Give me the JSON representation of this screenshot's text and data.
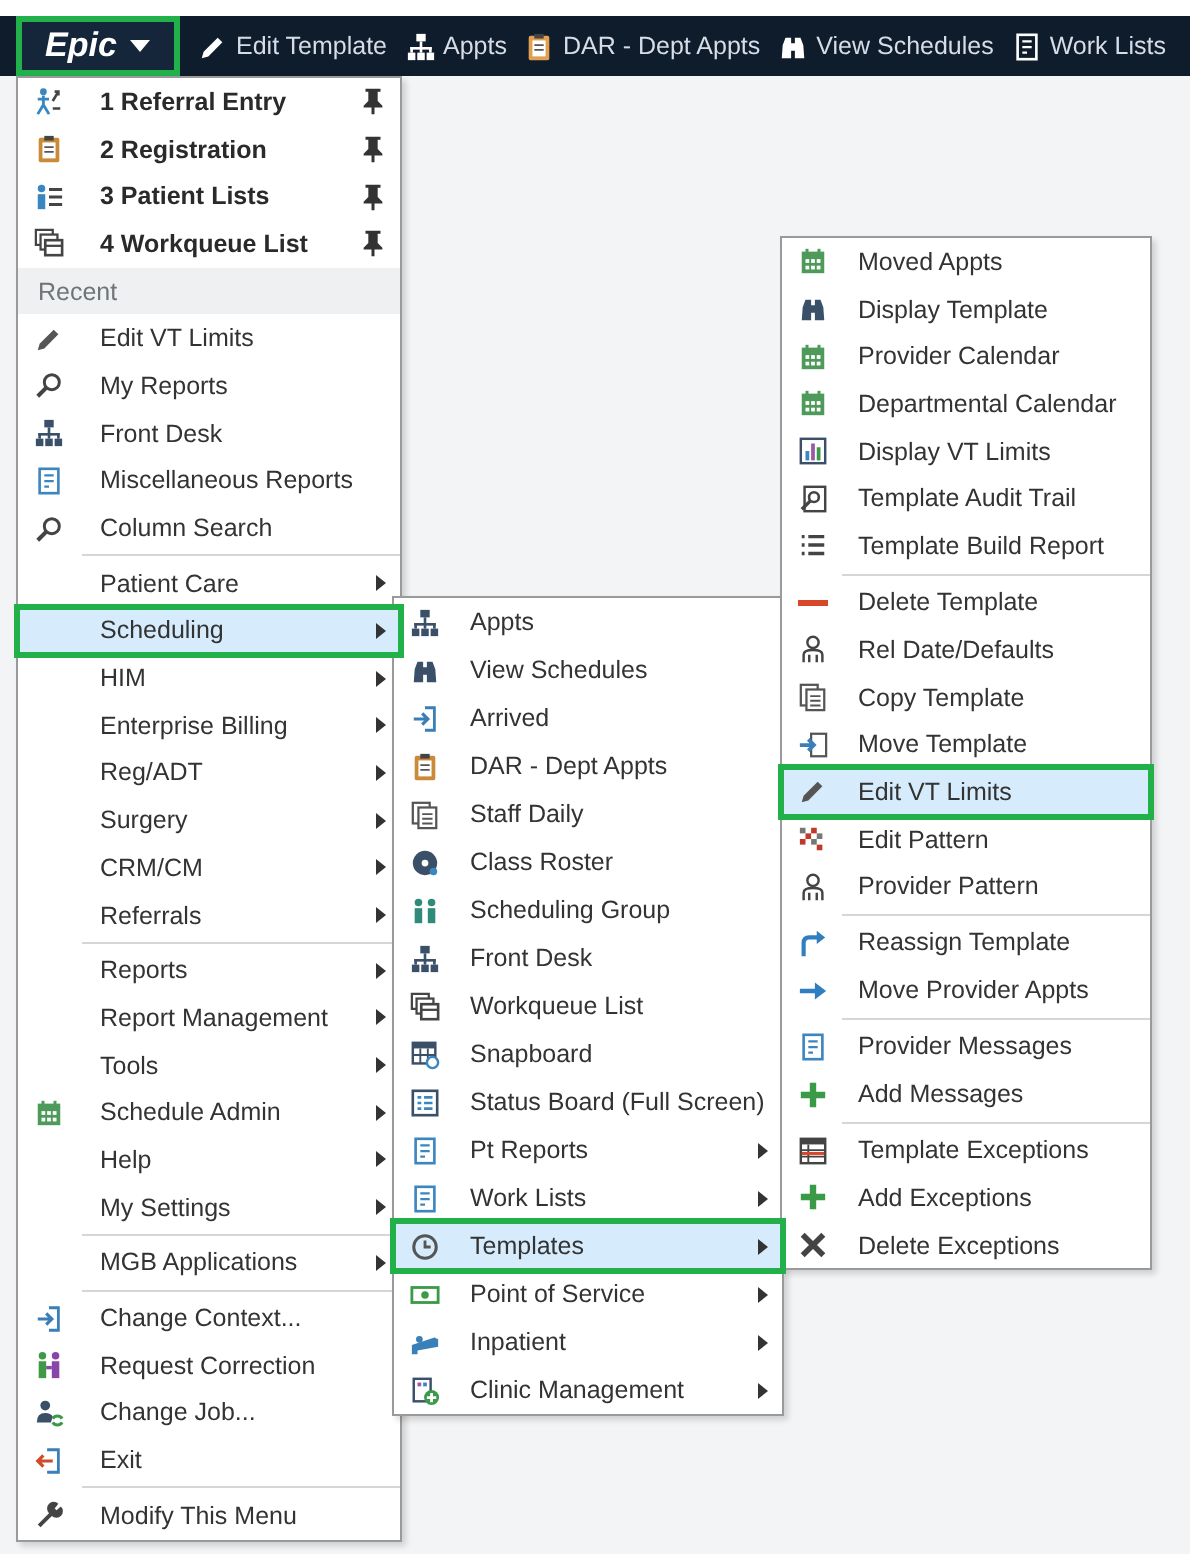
{
  "toolbar": {
    "menu_button": {
      "label": "Epic",
      "highlighted": true
    },
    "items": [
      {
        "label": "Edit Template"
      },
      {
        "label": "Appts"
      },
      {
        "label": "DAR - Dept Appts"
      },
      {
        "label": "View Schedules"
      },
      {
        "label": "Work Lists"
      }
    ]
  },
  "main_menu": {
    "entries": [
      {
        "kind": "item",
        "label": "1 Referral Entry",
        "pinned": true,
        "submenu": false,
        "selected": false
      },
      {
        "kind": "item",
        "label": "2 Registration",
        "pinned": true,
        "submenu": false,
        "selected": false
      },
      {
        "kind": "item",
        "label": "3 Patient Lists",
        "pinned": true,
        "submenu": false,
        "selected": false
      },
      {
        "kind": "item",
        "label": "4 Workqueue List",
        "pinned": true,
        "submenu": false,
        "selected": false
      },
      {
        "kind": "header",
        "label": "Recent"
      },
      {
        "kind": "item",
        "label": "Edit VT Limits",
        "pinned": false,
        "submenu": false,
        "selected": false
      },
      {
        "kind": "item",
        "label": "My Reports",
        "pinned": false,
        "submenu": false,
        "selected": false
      },
      {
        "kind": "item",
        "label": "Front Desk",
        "pinned": false,
        "submenu": false,
        "selected": false
      },
      {
        "kind": "item",
        "label": "Miscellaneous Reports",
        "pinned": false,
        "submenu": false,
        "selected": false
      },
      {
        "kind": "item",
        "label": "Column Search",
        "pinned": false,
        "submenu": false,
        "selected": false
      },
      {
        "kind": "separator"
      },
      {
        "kind": "item",
        "label": "Patient Care",
        "pinned": false,
        "submenu": true,
        "selected": false
      },
      {
        "kind": "item",
        "label": "Scheduling",
        "pinned": false,
        "submenu": true,
        "selected": true
      },
      {
        "kind": "item",
        "label": "HIM",
        "pinned": false,
        "submenu": true,
        "selected": false
      },
      {
        "kind": "item",
        "label": "Enterprise Billing",
        "pinned": false,
        "submenu": true,
        "selected": false
      },
      {
        "kind": "item",
        "label": "Reg/ADT",
        "pinned": false,
        "submenu": true,
        "selected": false
      },
      {
        "kind": "item",
        "label": "Surgery",
        "pinned": false,
        "submenu": true,
        "selected": false
      },
      {
        "kind": "item",
        "label": "CRM/CM",
        "pinned": false,
        "submenu": true,
        "selected": false
      },
      {
        "kind": "item",
        "label": "Referrals",
        "pinned": false,
        "submenu": true,
        "selected": false
      },
      {
        "kind": "separator"
      },
      {
        "kind": "item",
        "label": "Reports",
        "pinned": false,
        "submenu": true,
        "selected": false
      },
      {
        "kind": "item",
        "label": "Report Management",
        "pinned": false,
        "submenu": true,
        "selected": false
      },
      {
        "kind": "item",
        "label": "Tools",
        "pinned": false,
        "submenu": true,
        "selected": false
      },
      {
        "kind": "item",
        "label": "Schedule Admin",
        "pinned": false,
        "submenu": true,
        "selected": false
      },
      {
        "kind": "item",
        "label": "Help",
        "pinned": false,
        "submenu": true,
        "selected": false
      },
      {
        "kind": "item",
        "label": "My Settings",
        "pinned": false,
        "submenu": true,
        "selected": false
      },
      {
        "kind": "separator"
      },
      {
        "kind": "item",
        "label": "MGB Applications",
        "pinned": false,
        "submenu": true,
        "selected": false
      },
      {
        "kind": "separator"
      },
      {
        "kind": "item",
        "label": "Change Context...",
        "pinned": false,
        "submenu": false,
        "selected": false
      },
      {
        "kind": "item",
        "label": "Request Correction",
        "pinned": false,
        "submenu": false,
        "selected": false
      },
      {
        "kind": "item",
        "label": "Change Job...",
        "pinned": false,
        "submenu": false,
        "selected": false
      },
      {
        "kind": "item",
        "label": "Exit",
        "pinned": false,
        "submenu": false,
        "selected": false
      },
      {
        "kind": "separator"
      },
      {
        "kind": "item",
        "label": "Modify This Menu",
        "pinned": false,
        "submenu": false,
        "selected": false
      }
    ]
  },
  "scheduling_menu": {
    "entries": [
      {
        "kind": "item",
        "label": "Appts",
        "submenu": false,
        "selected": false
      },
      {
        "kind": "item",
        "label": "View Schedules",
        "submenu": false,
        "selected": false
      },
      {
        "kind": "item",
        "label": "Arrived",
        "submenu": false,
        "selected": false
      },
      {
        "kind": "item",
        "label": "DAR - Dept Appts",
        "submenu": false,
        "selected": false
      },
      {
        "kind": "item",
        "label": "Staff Daily",
        "submenu": false,
        "selected": false
      },
      {
        "kind": "item",
        "label": "Class Roster",
        "submenu": false,
        "selected": false
      },
      {
        "kind": "item",
        "label": "Scheduling Group",
        "submenu": false,
        "selected": false
      },
      {
        "kind": "item",
        "label": "Front Desk",
        "submenu": false,
        "selected": false
      },
      {
        "kind": "item",
        "label": "Workqueue List",
        "submenu": false,
        "selected": false
      },
      {
        "kind": "item",
        "label": "Snapboard",
        "submenu": false,
        "selected": false
      },
      {
        "kind": "item",
        "label": "Status Board (Full Screen)",
        "submenu": false,
        "selected": false
      },
      {
        "kind": "item",
        "label": "Pt Reports",
        "submenu": true,
        "selected": false
      },
      {
        "kind": "item",
        "label": "Work Lists",
        "submenu": true,
        "selected": false
      },
      {
        "kind": "item",
        "label": "Templates",
        "submenu": true,
        "selected": true
      },
      {
        "kind": "item",
        "label": "Point of Service",
        "submenu": true,
        "selected": false
      },
      {
        "kind": "item",
        "label": "Inpatient",
        "submenu": true,
        "selected": false
      },
      {
        "kind": "item",
        "label": "Clinic Management",
        "submenu": true,
        "selected": false
      }
    ]
  },
  "templates_menu": {
    "entries": [
      {
        "kind": "item",
        "label": "Moved Appts",
        "submenu": false,
        "selected": false
      },
      {
        "kind": "item",
        "label": "Display Template",
        "submenu": false,
        "selected": false
      },
      {
        "kind": "item",
        "label": "Provider Calendar",
        "submenu": false,
        "selected": false
      },
      {
        "kind": "item",
        "label": "Departmental Calendar",
        "submenu": false,
        "selected": false
      },
      {
        "kind": "item",
        "label": "Display VT Limits",
        "submenu": false,
        "selected": false
      },
      {
        "kind": "item",
        "label": "Template Audit Trail",
        "submenu": false,
        "selected": false
      },
      {
        "kind": "item",
        "label": "Template Build Report",
        "submenu": false,
        "selected": false
      },
      {
        "kind": "separator"
      },
      {
        "kind": "item",
        "label": "Delete Template",
        "submenu": false,
        "selected": false
      },
      {
        "kind": "item",
        "label": "Rel Date/Defaults",
        "submenu": false,
        "selected": false
      },
      {
        "kind": "item",
        "label": "Copy Template",
        "submenu": false,
        "selected": false
      },
      {
        "kind": "item",
        "label": "Move Template",
        "submenu": false,
        "selected": false
      },
      {
        "kind": "item",
        "label": "Edit VT Limits",
        "submenu": false,
        "selected": true
      },
      {
        "kind": "item",
        "label": "Edit Pattern",
        "submenu": false,
        "selected": false
      },
      {
        "kind": "item",
        "label": "Provider Pattern",
        "submenu": false,
        "selected": false
      },
      {
        "kind": "separator"
      },
      {
        "kind": "item",
        "label": "Reassign Template",
        "submenu": false,
        "selected": false
      },
      {
        "kind": "item",
        "label": "Move Provider Appts",
        "submenu": false,
        "selected": false
      },
      {
        "kind": "separator"
      },
      {
        "kind": "item",
        "label": "Provider Messages",
        "submenu": false,
        "selected": false
      },
      {
        "kind": "item",
        "label": "Add Messages",
        "submenu": false,
        "selected": false
      },
      {
        "kind": "separator"
      },
      {
        "kind": "item",
        "label": "Template Exceptions",
        "submenu": false,
        "selected": false
      },
      {
        "kind": "item",
        "label": "Add Exceptions",
        "submenu": false,
        "selected": false
      },
      {
        "kind": "item",
        "label": "Delete Exceptions",
        "submenu": false,
        "selected": false
      }
    ]
  }
}
